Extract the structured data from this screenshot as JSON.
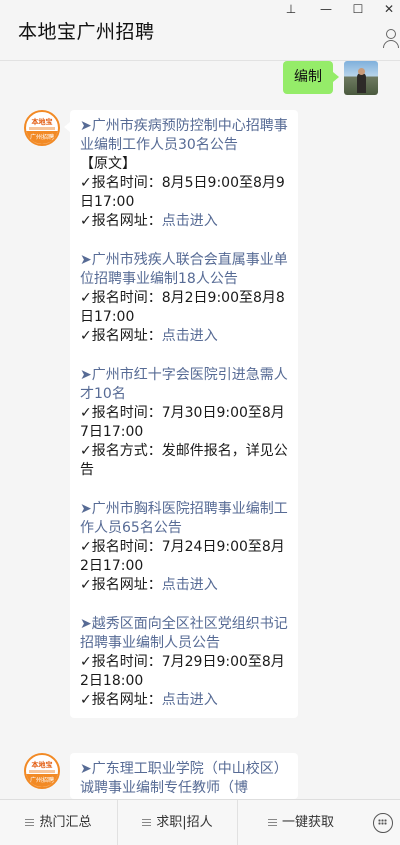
{
  "header": {
    "title": "本地宝广州招聘",
    "pin_icon": "pin-icon",
    "minimize_icon": "minimize-icon",
    "maximize_icon": "maximize-icon",
    "close_icon": "close-icon",
    "profile_icon": "user-icon"
  },
  "my_message": {
    "text": "编制"
  },
  "bot": {
    "avatar_text_top": "本地宝",
    "avatar_text_bottom": "广州招聘"
  },
  "message1": {
    "items": [
      {
        "title": "➤广州市疾病预防控制中心招聘事业编制工作人员30名公告",
        "title_suffix": "【原文】",
        "time_label": "✓报名时间：",
        "time_value": "8月5日9:00至8月9日17:00",
        "contact_label": "✓报名网址：",
        "contact_value": "点击进入"
      },
      {
        "title": "➤广州市残疾人联合会直属事业单位招聘事业编制18人公告",
        "title_suffix": "",
        "time_label": "✓报名时间：",
        "time_value": "8月2日9:00至8月8日17:00",
        "contact_label": "✓报名网址：",
        "contact_value": "点击进入"
      },
      {
        "title": "➤广州市红十字会医院引进急需人才10名",
        "title_suffix": "",
        "time_label": "✓报名时间：",
        "time_value": "7月30日9:00至8月7日17:00",
        "contact_label": "✓报名方式：",
        "contact_value": "发邮件报名，详见公告"
      },
      {
        "title": "➤广州市胸科医院招聘事业编制工作人员65名公告",
        "title_suffix": "",
        "time_label": "✓报名时间：",
        "time_value": "7月24日9:00至8月2日17:00",
        "contact_label": "✓报名网址：",
        "contact_value": "点击进入"
      },
      {
        "title": "➤越秀区面向全区社区党组织书记招聘事业编制人员公告",
        "title_suffix": "",
        "time_label": "✓报名时间：",
        "time_value": "7月29日9:00至8月2日18:00",
        "contact_label": "✓报名网址：",
        "contact_value": "点击进入"
      }
    ]
  },
  "message2": {
    "partial_title": "➤广东理工职业学院（中山校区）诚聘事业编制专任教师（博"
  },
  "bottom_menu": {
    "items": [
      "热门汇总",
      "求职|招人",
      "一键获取"
    ],
    "keyboard_icon": "keyboard-icon"
  }
}
